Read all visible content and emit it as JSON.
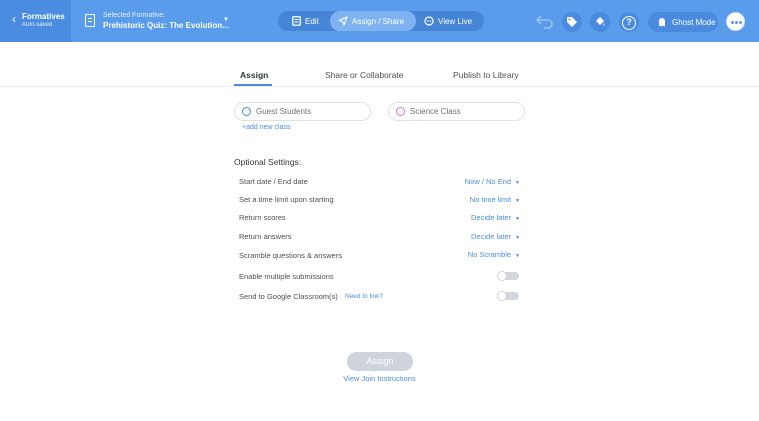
{
  "header": {
    "back_label": "Formatives",
    "autosave": "Auto-saved",
    "selected_label": "Selected Formative:",
    "selected_title": "Prehistoric Quiz: The Evolution...",
    "modes": [
      {
        "label": "Edit",
        "icon": "edit-icon"
      },
      {
        "label": "Assign / Share",
        "icon": "send-icon"
      },
      {
        "label": "View Live",
        "icon": "chat-icon"
      }
    ],
    "active_mode": "Assign / Share",
    "ghost_label": "Ghost Mode",
    "help_glyph": "?"
  },
  "tabs": [
    {
      "label": "Assign"
    },
    {
      "label": "Share or Collaborate"
    },
    {
      "label": "Publish to Library"
    }
  ],
  "classes": [
    {
      "label": "Guest Students",
      "color": "#4a8de0"
    },
    {
      "label": "Science Class",
      "color": "#d66fd6"
    }
  ],
  "add_class": "+add new class",
  "optional_title": "Optional Settings:",
  "settings": [
    {
      "label": "Start date / End date",
      "value": "Now / No End"
    },
    {
      "label": "Set a time limit upon starting",
      "value": "No time limit"
    },
    {
      "label": "Return scores",
      "value": "Decide later"
    },
    {
      "label": "Return answers",
      "value": "Decide later"
    },
    {
      "label": "Scramble questions & answers",
      "value": "No Scramble"
    },
    {
      "label": "Enable multiple submissions",
      "toggle": false
    },
    {
      "label": "Send to Google Classroom(s)",
      "toggle": false,
      "link": "Need to link?"
    }
  ],
  "assign_button": "Assign",
  "join_link": "View Join Instructions",
  "colors": {
    "accent": "#5a9cec",
    "link": "#4a8de0",
    "disabled": "#cfd4db"
  }
}
